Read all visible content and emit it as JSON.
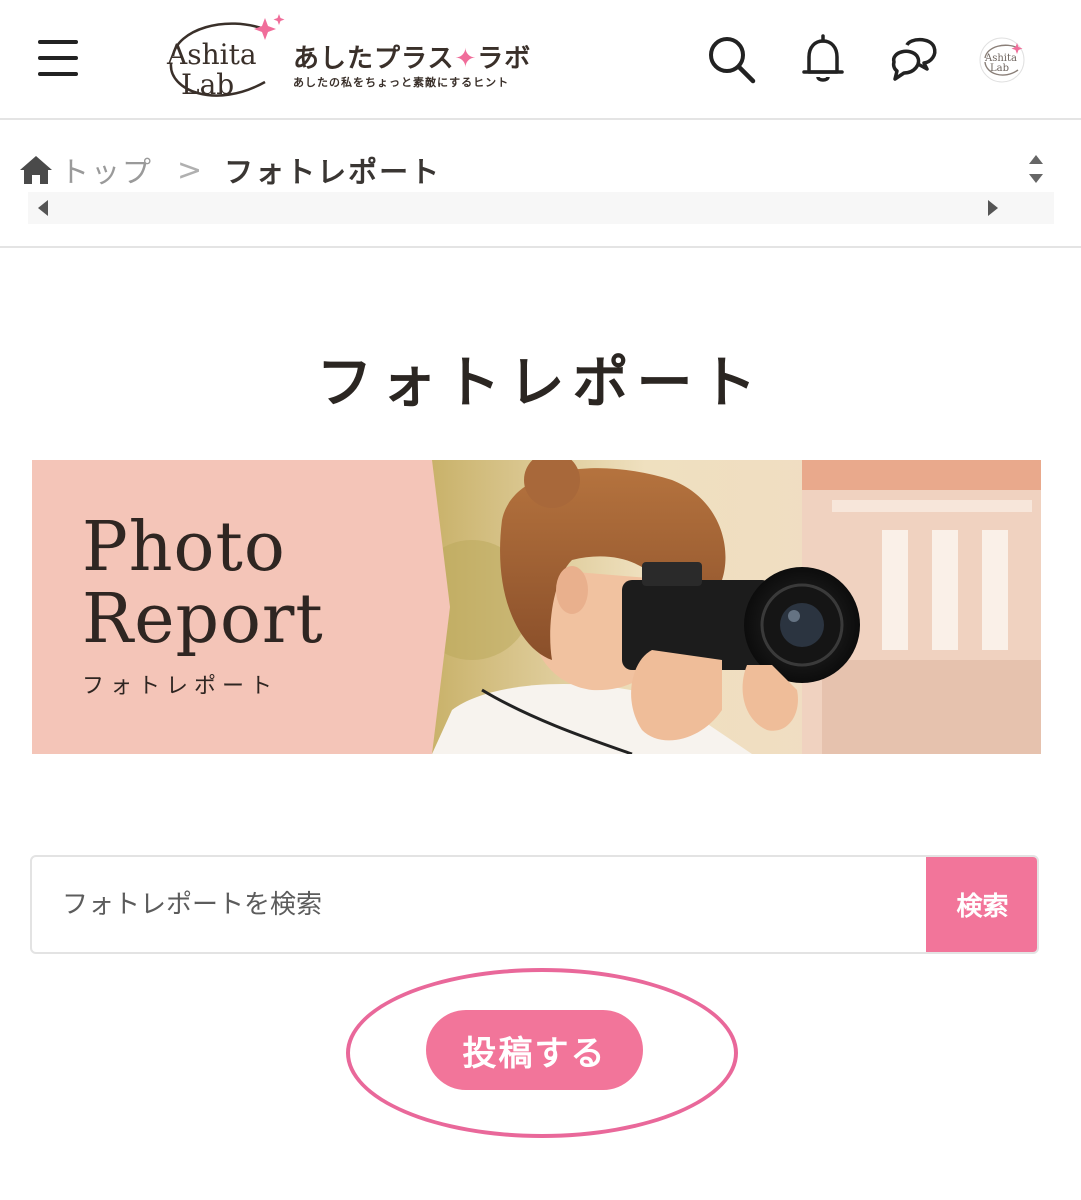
{
  "header": {
    "logo_mark_line1": "Ashita",
    "logo_mark_line2": "Lab",
    "logo_name_part1": "あしたプラス",
    "logo_name_spark": "✦",
    "logo_name_part2": "ラボ",
    "logo_tagline": "あしたの私をちょっと素敵にするヒント",
    "icons": [
      "menu-icon",
      "search-icon",
      "bell-icon",
      "chat-icon",
      "avatar"
    ]
  },
  "breadcrumb": {
    "home": "トップ",
    "separator": ">",
    "current": "フォトレポート"
  },
  "page": {
    "title": "フォトレポート"
  },
  "banner": {
    "title": "Photo\nReport",
    "subtitle": "フォトレポート"
  },
  "search": {
    "placeholder": "フォトレポートを検索",
    "value": "",
    "button_label": "検索"
  },
  "post": {
    "button_label": "投稿する"
  },
  "colors": {
    "accent_pink": "#f2759a",
    "highlight_ring": "#e9689a",
    "banner_pink": "#f4c5b8",
    "text_dark": "#2b2622"
  }
}
